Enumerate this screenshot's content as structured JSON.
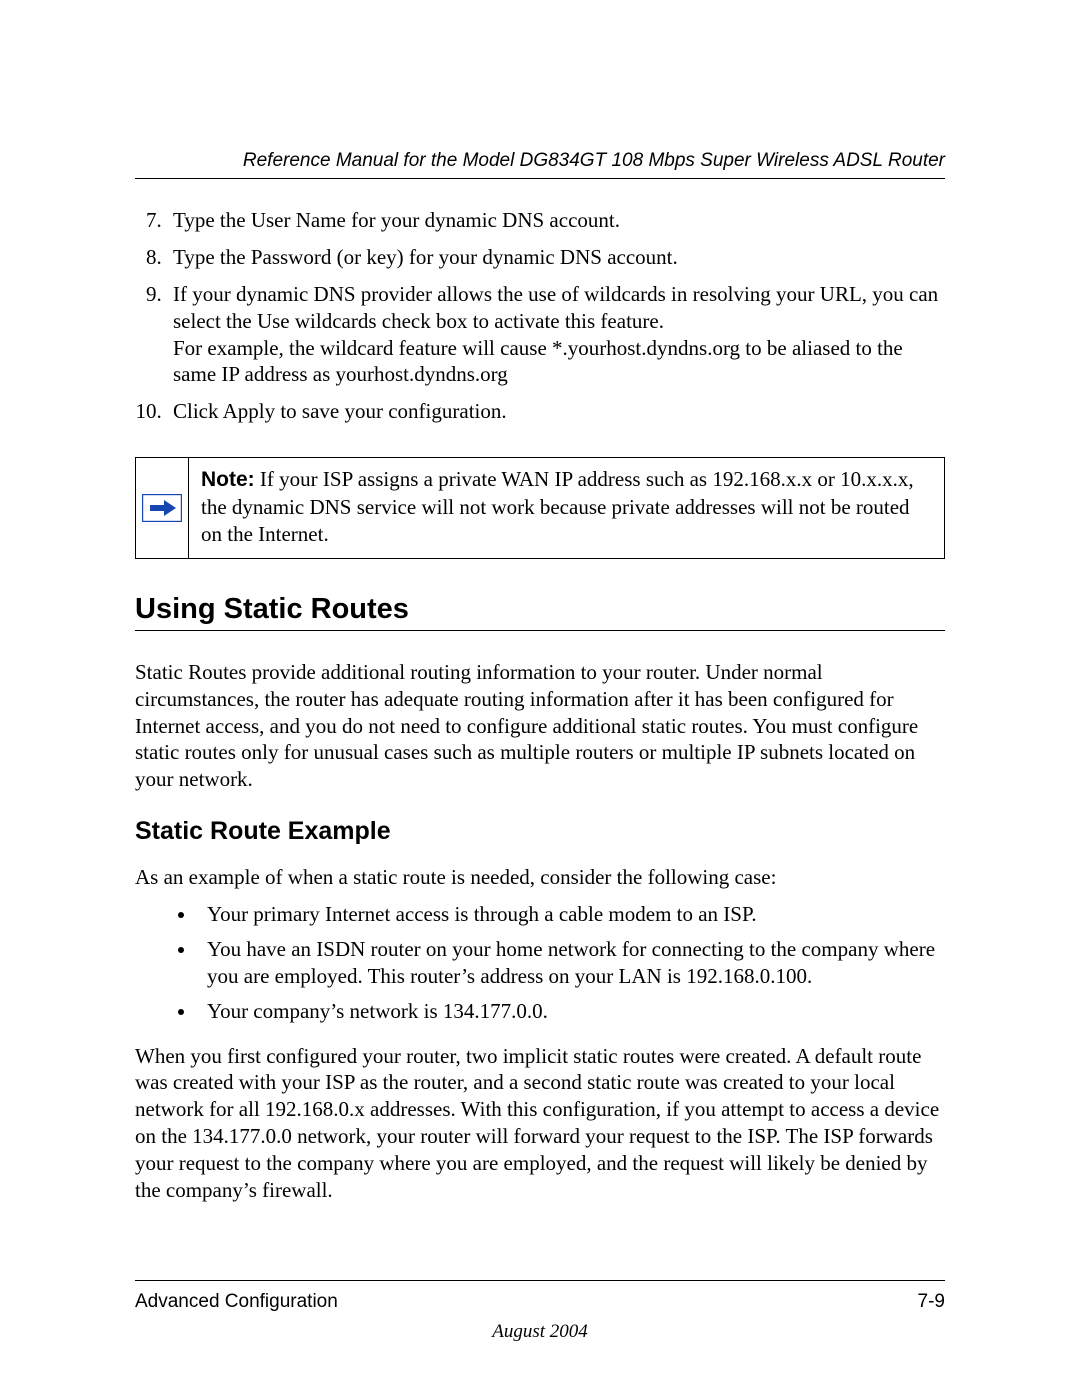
{
  "header": {
    "running_title": "Reference Manual for the Model DG834GT 108 Mbps Super Wireless ADSL Router"
  },
  "steps": {
    "start": 7,
    "items": [
      "Type the User Name for your dynamic DNS account.",
      "Type the Password (or key) for your dynamic DNS account.",
      "If your dynamic DNS provider allows the use of wildcards in resolving your URL, you can select the Use wildcards check box to activate this feature.\nFor example, the wildcard feature will cause *.yourhost.dyndns.org to be aliased to the same IP address as yourhost.dyndns.org",
      "Click Apply to save your configuration."
    ]
  },
  "note": {
    "label": "Note:",
    "text": " If your ISP assigns a private WAN IP address such as 192.168.x.x or 10.x.x.x, the dynamic DNS service will not work because private addresses will not be routed on the Internet.",
    "icon_name": "arrow-right-icon"
  },
  "section": {
    "h2": "Using Static Routes",
    "intro": "Static Routes provide additional routing information to your router. Under normal circumstances, the router has adequate routing information after it has been configured for Internet access, and you do not need to configure additional static routes. You must configure static routes only for unusual cases such as multiple routers or multiple IP subnets located on your network.",
    "h3": "Static Route Example",
    "lead": "As an example of when a static route is needed, consider the following case:",
    "bullets": [
      "Your primary Internet access is through a cable modem to an ISP.",
      "You have an ISDN router on your home network for connecting to the company where you are employed. This router’s address on your LAN is 192.168.0.100.",
      "Your company’s network is 134.177.0.0."
    ],
    "after": "When you first configured your router, two implicit static routes were created. A default route was created with your ISP as the router, and a second static route was created to your local network for all 192.168.0.x addresses. With this configuration, if you attempt to access a device on the 134.177.0.0 network, your router will forward your request to the ISP. The ISP forwards your request to the company where you are employed, and the request will likely be denied by the company’s firewall."
  },
  "footer": {
    "section": "Advanced Configuration",
    "page": "7-9",
    "date": "August 2004"
  }
}
